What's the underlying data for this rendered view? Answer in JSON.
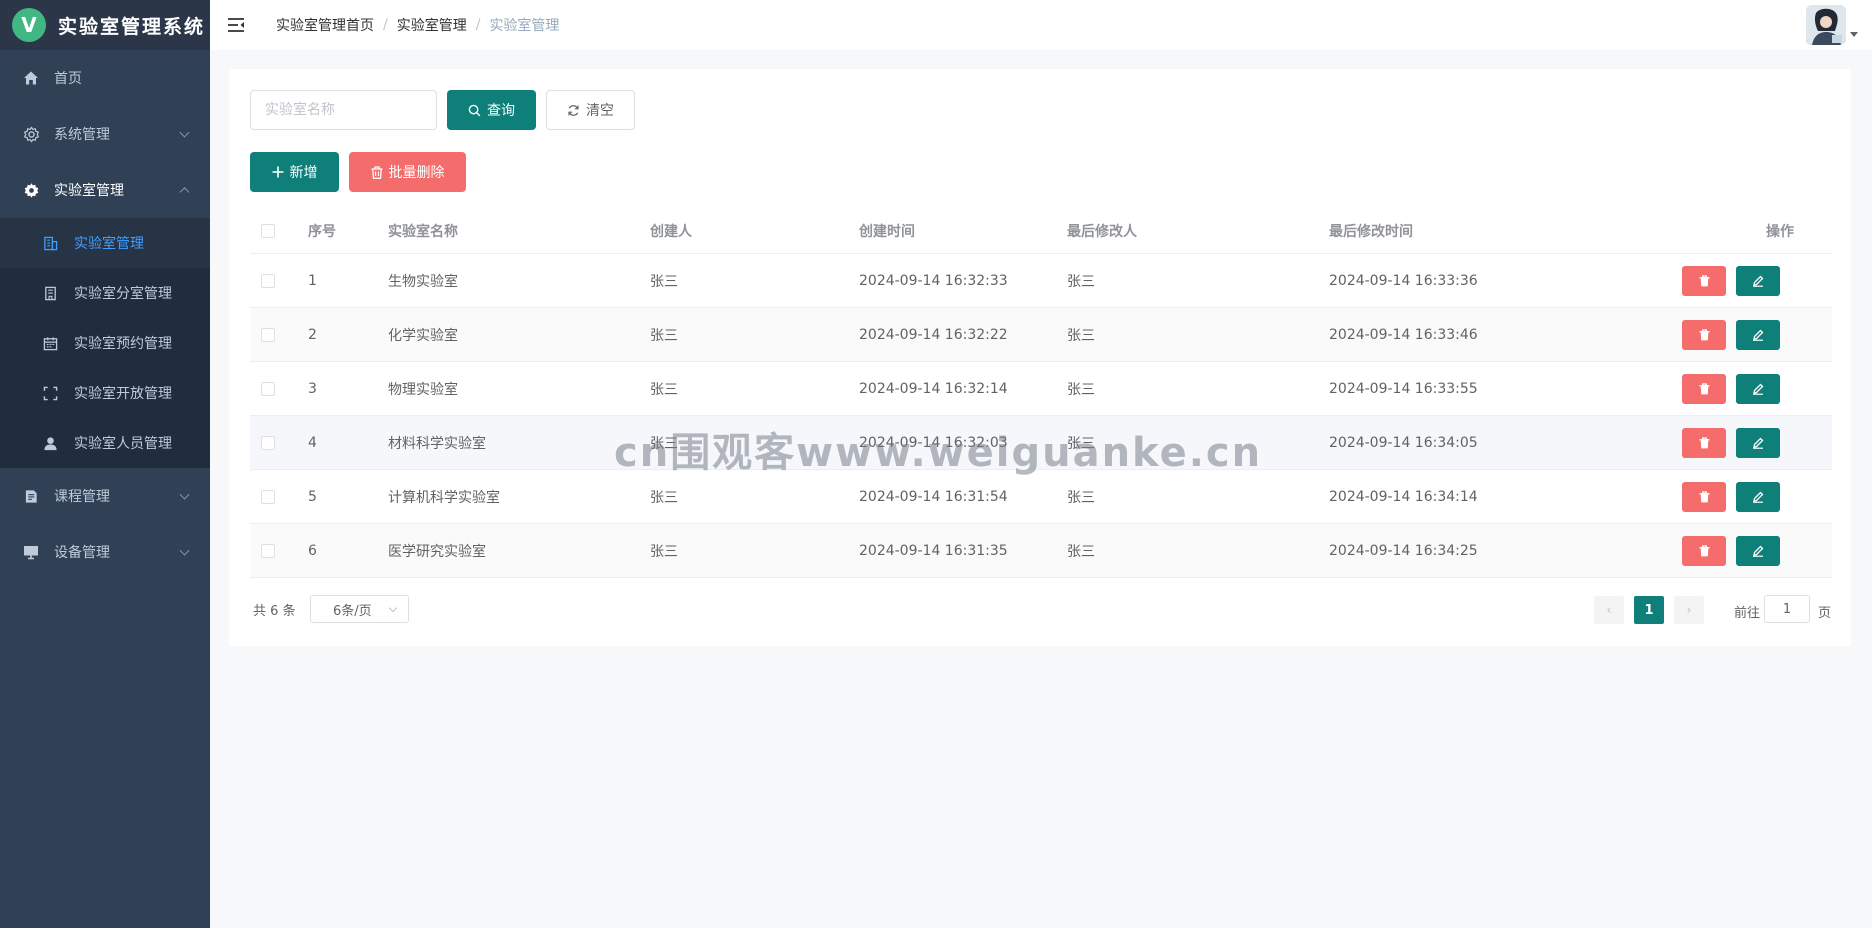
{
  "app": {
    "logo_letter": "V",
    "title": "实验室管理系统"
  },
  "sidebar": {
    "items": [
      {
        "label": "首页",
        "icon": "home-icon"
      },
      {
        "label": "系统管理",
        "icon": "gear-outline-icon"
      },
      {
        "label": "实验室管理",
        "icon": "gear-icon"
      },
      {
        "label": "课程管理",
        "icon": "document-icon"
      },
      {
        "label": "设备管理",
        "icon": "monitor-icon"
      }
    ],
    "sub_items": [
      {
        "label": "实验室管理",
        "icon": "building-icon"
      },
      {
        "label": "实验室分室管理",
        "icon": "office-icon"
      },
      {
        "label": "实验室预约管理",
        "icon": "calendar-icon"
      },
      {
        "label": "实验室开放管理",
        "icon": "fullscreen-icon"
      },
      {
        "label": "实验室人员管理",
        "icon": "user-icon"
      }
    ]
  },
  "header": {
    "breadcrumb": [
      "实验室管理首页",
      "实验室管理",
      "实验室管理"
    ],
    "separator": "/"
  },
  "toolbar": {
    "search_placeholder": "实验室名称",
    "search_value": "",
    "query_label": "查询",
    "clear_label": "清空",
    "add_label": "新增",
    "batch_delete_label": "批量删除"
  },
  "table": {
    "columns": [
      "序号",
      "实验室名称",
      "创建人",
      "创建时间",
      "最后修改人",
      "最后修改时间",
      "操作"
    ],
    "rows": [
      {
        "idx": "1",
        "name": "生物实验室",
        "creator": "张三",
        "created": "2024-09-14 16:32:33",
        "modifier": "张三",
        "modified": "2024-09-14 16:33:36"
      },
      {
        "idx": "2",
        "name": "化学实验室",
        "creator": "张三",
        "created": "2024-09-14 16:32:22",
        "modifier": "张三",
        "modified": "2024-09-14 16:33:46"
      },
      {
        "idx": "3",
        "name": "物理实验室",
        "creator": "张三",
        "created": "2024-09-14 16:32:14",
        "modifier": "张三",
        "modified": "2024-09-14 16:33:55"
      },
      {
        "idx": "4",
        "name": "材料科学实验室",
        "creator": "张三",
        "created": "2024-09-14 16:32:03",
        "modifier": "张三",
        "modified": "2024-09-14 16:34:05"
      },
      {
        "idx": "5",
        "name": "计算机科学实验室",
        "creator": "张三",
        "created": "2024-09-14 16:31:54",
        "modifier": "张三",
        "modified": "2024-09-14 16:34:14"
      },
      {
        "idx": "6",
        "name": "医学研究实验室",
        "creator": "张三",
        "created": "2024-09-14 16:31:35",
        "modifier": "张三",
        "modified": "2024-09-14 16:34:25"
      }
    ]
  },
  "pagination": {
    "total_text": "共 6 条",
    "page_size": "6条/页",
    "prev": "‹",
    "current": "1",
    "next": "›",
    "goto_label": "前往",
    "goto_value": "1",
    "goto_unit": "页"
  },
  "watermark": "cn围观客www.weiguanke.cn",
  "colors": {
    "primary": "#0f7f7a",
    "danger": "#f56c6c",
    "sidebar": "#304156",
    "active": "#409eff"
  }
}
